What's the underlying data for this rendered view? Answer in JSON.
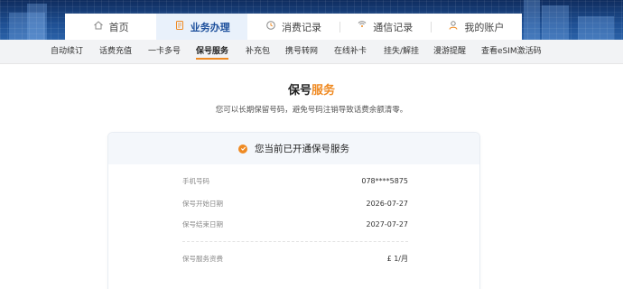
{
  "main_nav": {
    "tabs": [
      {
        "label": "首页",
        "icon": "home-icon",
        "active": false
      },
      {
        "label": "业务办理",
        "icon": "document-icon",
        "active": true
      },
      {
        "label": "消费记录",
        "icon": "clock-coin-icon",
        "active": false
      },
      {
        "label": "通信记录",
        "icon": "signal-icon",
        "active": false
      },
      {
        "label": "我的账户",
        "icon": "user-icon",
        "active": false
      }
    ]
  },
  "sub_nav": {
    "items": [
      "自动续订",
      "话费充值",
      "一卡多号",
      "保号服务",
      "补充包",
      "携号转网",
      "在线补卡",
      "挂失/解挂",
      "漫游提醒",
      "查看eSIM激活码"
    ],
    "active": "保号服务"
  },
  "page": {
    "title_main": "保号",
    "title_accent": "服务",
    "description": "您可以长期保留号码，避免号码注销导致话费余额清零。"
  },
  "card": {
    "status_text": "您当前已开通保号服务",
    "rows": [
      {
        "label": "手机号码",
        "value": "078****5875"
      },
      {
        "label": "保号开始日期",
        "value": "2026-07-27"
      },
      {
        "label": "保号结束日期",
        "value": "2027-07-27"
      },
      {
        "label": "保号服务资费",
        "value": "£ 1/月"
      }
    ]
  },
  "colors": {
    "accent": "#ef8a22",
    "nav_active_bg": "#e9f1fb",
    "banner": "#1e4f93"
  }
}
